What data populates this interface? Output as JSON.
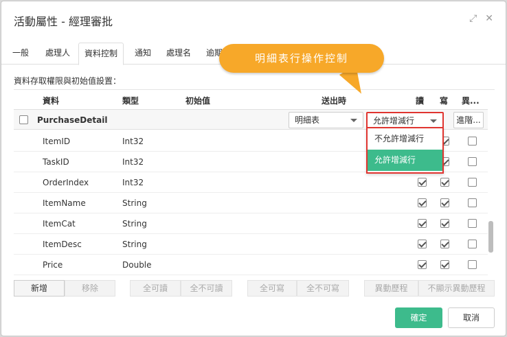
{
  "window": {
    "title": "活動屬性 - 經理審批"
  },
  "tabs": [
    {
      "label": "一般"
    },
    {
      "label": "處理人"
    },
    {
      "label": "資料控制"
    },
    {
      "label": "通知"
    },
    {
      "label": "處理名"
    },
    {
      "label": "逾期"
    }
  ],
  "active_tab": "資料控制",
  "section_label": "資料存取權限與初始值設置：",
  "columns": {
    "data": "資料",
    "type": "類型",
    "initial": "初始值",
    "output": "送出時",
    "read": "讀",
    "write": "寫",
    "diff": "異..."
  },
  "master_row": {
    "name": "PurchaseDetail",
    "output_select": "明細表",
    "rows_select": "允許增減行",
    "advanced": "進階..."
  },
  "dropdown": {
    "options": [
      "不允許增減行",
      "允許增減行"
    ],
    "selected": "允許增減行"
  },
  "rows": [
    {
      "name": "ItemID",
      "type": "Int32",
      "read": true,
      "write": true,
      "diff": false
    },
    {
      "name": "TaskID",
      "type": "Int32",
      "read": true,
      "write": true,
      "diff": false
    },
    {
      "name": "OrderIndex",
      "type": "Int32",
      "read": true,
      "write": true,
      "diff": false
    },
    {
      "name": "ItemName",
      "type": "String",
      "read": true,
      "write": true,
      "diff": false
    },
    {
      "name": "ItemCat",
      "type": "String",
      "read": true,
      "write": true,
      "diff": false
    },
    {
      "name": "ItemDesc",
      "type": "String",
      "read": true,
      "write": true,
      "diff": false
    },
    {
      "name": "Price",
      "type": "Double",
      "read": true,
      "write": true,
      "diff": false
    }
  ],
  "toolbar": {
    "add": "新增",
    "remove": "移除",
    "all_read": "全可讀",
    "none_read": "全不可讀",
    "all_write": "全可寫",
    "none_write": "全不可寫",
    "diff_history": "異動歷程",
    "hide_diff_history": "不顯示異動歷程"
  },
  "footer": {
    "ok": "確定",
    "cancel": "取消"
  },
  "callout": {
    "text": "明細表行操作控制"
  },
  "colors": {
    "accent": "#3dbb8c",
    "callout": "#f7a829",
    "highlight": "#e0342f"
  }
}
